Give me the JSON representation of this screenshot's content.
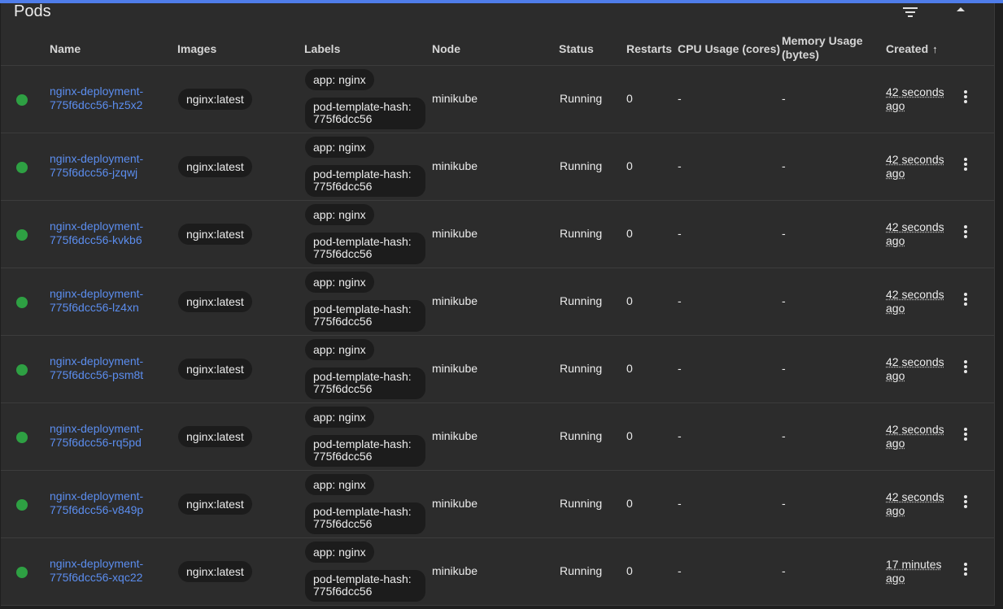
{
  "card": {
    "title": "Pods",
    "icons": {
      "filter": "filter-icon",
      "collapse": "chevron-up-icon"
    }
  },
  "columns": {
    "name": "Name",
    "images": "Images",
    "labels": "Labels",
    "node": "Node",
    "status": "Status",
    "restarts": "Restarts",
    "cpu": "CPU Usage (cores)",
    "memory": "Memory Usage (bytes)",
    "created": "Created",
    "sort_icon": "arrow-up-icon"
  },
  "colors": {
    "accent": "#4f7dea",
    "link": "#5b8dee",
    "status_running": "#2ea043",
    "background": "#2c2c2c"
  },
  "pods": [
    {
      "name": "nginx-deployment-775f6dcc56-hz5x2",
      "image": "nginx:latest",
      "labels": [
        "app: nginx",
        "pod-template-hash: 775f6dcc56"
      ],
      "node": "minikube",
      "status": "Running",
      "restarts": "0",
      "cpu": "-",
      "memory": "-",
      "created": "42 seconds ago"
    },
    {
      "name": "nginx-deployment-775f6dcc56-jzqwj",
      "image": "nginx:latest",
      "labels": [
        "app: nginx",
        "pod-template-hash: 775f6dcc56"
      ],
      "node": "minikube",
      "status": "Running",
      "restarts": "0",
      "cpu": "-",
      "memory": "-",
      "created": "42 seconds ago"
    },
    {
      "name": "nginx-deployment-775f6dcc56-kvkb6",
      "image": "nginx:latest",
      "labels": [
        "app: nginx",
        "pod-template-hash: 775f6dcc56"
      ],
      "node": "minikube",
      "status": "Running",
      "restarts": "0",
      "cpu": "-",
      "memory": "-",
      "created": "42 seconds ago"
    },
    {
      "name": "nginx-deployment-775f6dcc56-lz4xn",
      "image": "nginx:latest",
      "labels": [
        "app: nginx",
        "pod-template-hash: 775f6dcc56"
      ],
      "node": "minikube",
      "status": "Running",
      "restarts": "0",
      "cpu": "-",
      "memory": "-",
      "created": "42 seconds ago"
    },
    {
      "name": "nginx-deployment-775f6dcc56-psm8t",
      "image": "nginx:latest",
      "labels": [
        "app: nginx",
        "pod-template-hash: 775f6dcc56"
      ],
      "node": "minikube",
      "status": "Running",
      "restarts": "0",
      "cpu": "-",
      "memory": "-",
      "created": "42 seconds ago"
    },
    {
      "name": "nginx-deployment-775f6dcc56-rq5pd",
      "image": "nginx:latest",
      "labels": [
        "app: nginx",
        "pod-template-hash: 775f6dcc56"
      ],
      "node": "minikube",
      "status": "Running",
      "restarts": "0",
      "cpu": "-",
      "memory": "-",
      "created": "42 seconds ago"
    },
    {
      "name": "nginx-deployment-775f6dcc56-v849p",
      "image": "nginx:latest",
      "labels": [
        "app: nginx",
        "pod-template-hash: 775f6dcc56"
      ],
      "node": "minikube",
      "status": "Running",
      "restarts": "0",
      "cpu": "-",
      "memory": "-",
      "created": "42 seconds ago"
    },
    {
      "name": "nginx-deployment-775f6dcc56-xqc22",
      "image": "nginx:latest",
      "labels": [
        "app: nginx",
        "pod-template-hash: 775f6dcc56"
      ],
      "node": "minikube",
      "status": "Running",
      "restarts": "0",
      "cpu": "-",
      "memory": "-",
      "created": "17 minutes ago"
    }
  ]
}
